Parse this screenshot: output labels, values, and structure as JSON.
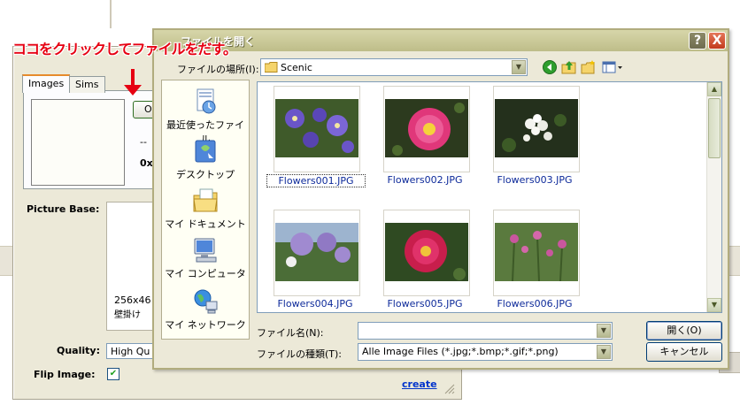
{
  "annotation": {
    "text": "ココをクリックしてファイルをだす。"
  },
  "main": {
    "tabs": [
      {
        "label": "Images"
      },
      {
        "label": "Sims"
      }
    ],
    "open_button_label": "O",
    "info_line1": "--",
    "info_line2": "0x",
    "picture_base_label": "Picture Base:",
    "picture_base_size": "256x46",
    "picture_base_note": "壁掛け",
    "quality_label": "Quality:",
    "quality_value": "High Qu",
    "flip_label": "Flip Image:",
    "flip_checked": true,
    "create_label": "create"
  },
  "dialog": {
    "title": "ファイルを開く",
    "help_button": "?",
    "close_button": "X",
    "look_in_label": "ファイルの場所(I):",
    "look_in_value": "Scenic",
    "places": [
      {
        "label": "最近使ったファイル",
        "icon": "recent-icon"
      },
      {
        "label": "デスクトップ",
        "icon": "desktop-icon"
      },
      {
        "label": "マイ ドキュメント",
        "icon": "my-documents-icon"
      },
      {
        "label": "マイ コンピュータ",
        "icon": "my-computer-icon"
      },
      {
        "label": "マイ ネットワーク",
        "icon": "my-network-icon"
      }
    ],
    "files": [
      {
        "name": "Flowers001.JPG",
        "selected": true
      },
      {
        "name": "Flowers002.JPG",
        "selected": false
      },
      {
        "name": "Flowers003.JPG",
        "selected": false
      },
      {
        "name": "Flowers004.JPG",
        "selected": false
      },
      {
        "name": "Flowers005.JPG",
        "selected": false
      },
      {
        "name": "Flowers006.JPG",
        "selected": false
      }
    ],
    "filename_label": "ファイル名(N):",
    "filename_value": "",
    "filetype_label": "ファイルの種類(T):",
    "filetype_value": "Alle Image Files (*.jpg;*.bmp;*.gif;*.png)",
    "open_button": "開く(O)",
    "cancel_button": "キャンセル"
  }
}
